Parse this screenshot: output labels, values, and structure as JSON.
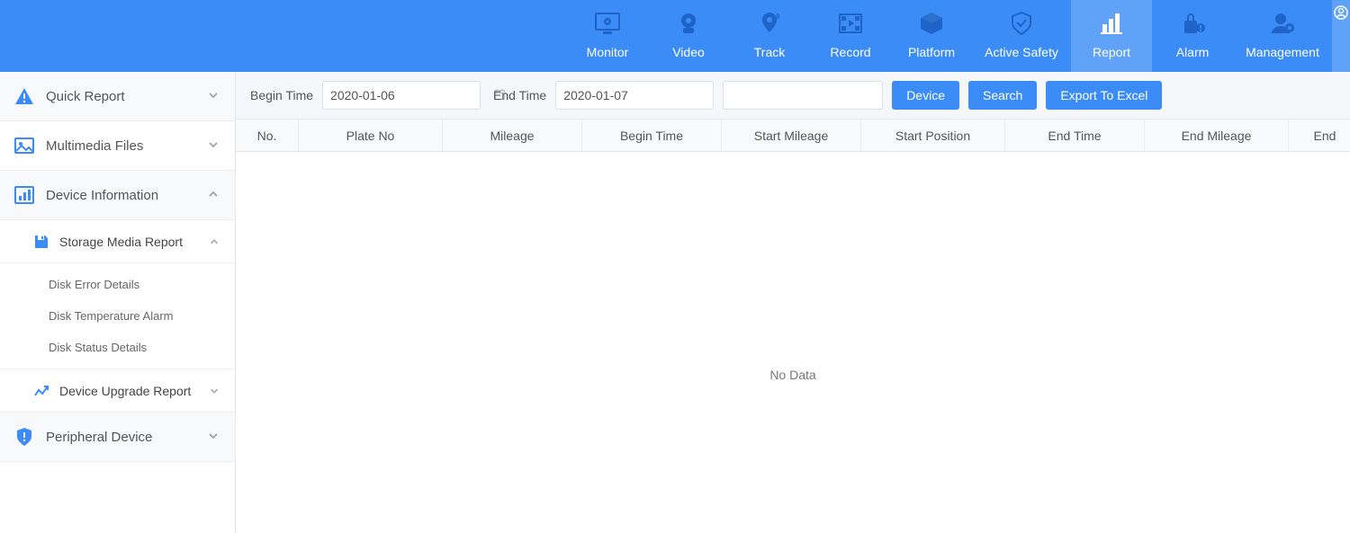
{
  "topnav": {
    "items": [
      {
        "label": "Monitor"
      },
      {
        "label": "Video"
      },
      {
        "label": "Track"
      },
      {
        "label": "Record"
      },
      {
        "label": "Platform"
      },
      {
        "label": "Active Safety"
      },
      {
        "label": "Report"
      },
      {
        "label": "Alarm"
      },
      {
        "label": "Management"
      }
    ]
  },
  "sidebar": {
    "quick_report": "Quick Report",
    "multimedia_files": "Multimedia Files",
    "device_information": "Device Information",
    "storage_media_report": "Storage Media Report",
    "disk_error_details": "Disk Error Details",
    "disk_temperature_alarm": "Disk Temperature Alarm",
    "disk_status_details": "Disk Status Details",
    "device_upgrade_report": "Device Upgrade Report",
    "peripheral_device": "Peripheral Device"
  },
  "toolbar": {
    "begin_time_label": "Begin Time",
    "begin_time_value": "2020-01-06",
    "end_time_label": "End Time",
    "end_time_value": "2020-01-07",
    "search_value": "",
    "device_btn": "Device",
    "search_btn": "Search",
    "export_btn": "Export To Excel"
  },
  "table": {
    "columns": [
      "No.",
      "Plate No",
      "Mileage",
      "Begin Time",
      "Start Mileage",
      "Start Position",
      "End Time",
      "End Mileage",
      "End"
    ],
    "nodata": "No Data",
    "rows": []
  }
}
